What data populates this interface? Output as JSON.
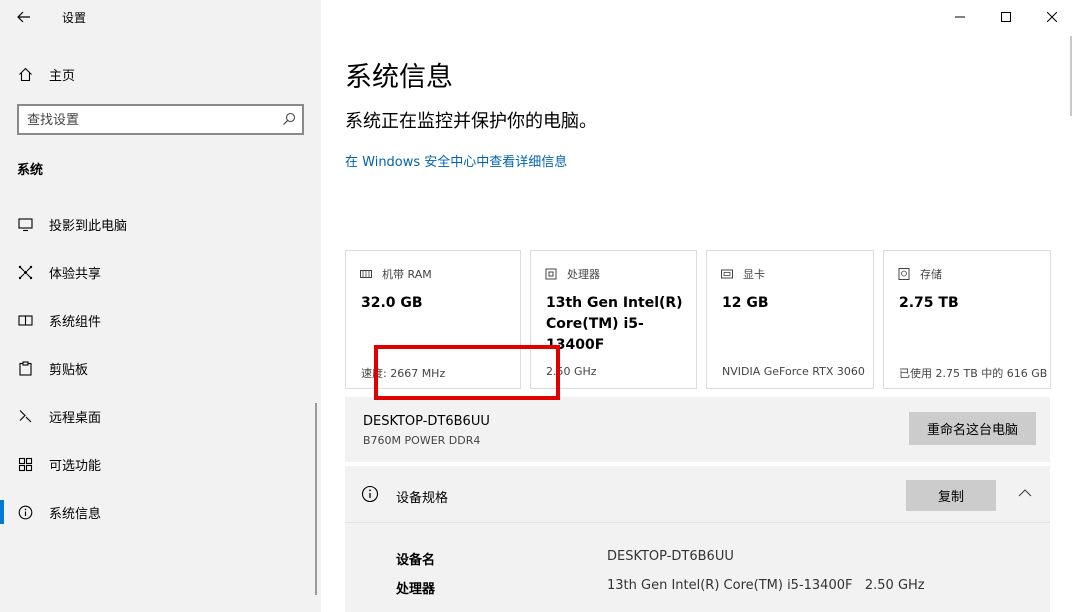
{
  "window": {
    "app_title": "设置"
  },
  "sidebar": {
    "home_label": "主页",
    "search": {
      "placeholder": "查找设置"
    },
    "section_label": "系统",
    "items": [
      {
        "label": "投影到此电脑",
        "icon": "projector-icon"
      },
      {
        "label": "体验共享",
        "icon": "share-icon"
      },
      {
        "label": "系统组件",
        "icon": "components-icon"
      },
      {
        "label": "剪贴板",
        "icon": "clipboard-icon"
      },
      {
        "label": "远程桌面",
        "icon": "remote-desktop-icon"
      },
      {
        "label": "可选功能",
        "icon": "optional-features-icon"
      },
      {
        "label": "系统信息",
        "icon": "info-icon",
        "active": true
      }
    ]
  },
  "main": {
    "title": "系统信息",
    "subtitle": "系统正在监控并保护你的电脑。",
    "security_link": "在 Windows 安全中心中查看详细信息",
    "cards": [
      {
        "label": "机带 RAM",
        "value": "32.0 GB",
        "detail": "速度: 2667 MHz",
        "icon": "memory-icon"
      },
      {
        "label": "处理器",
        "value": "13th Gen Intel(R) Core(TM) i5-13400F",
        "detail": "2.50 GHz",
        "icon": "processor-icon"
      },
      {
        "label": "显卡",
        "value": "12 GB",
        "detail": "NVIDIA GeForce RTX 3060",
        "icon": "gpu-icon"
      },
      {
        "label": "存储",
        "value": "2.75 TB",
        "detail": "已使用 2.75 TB 中的 616 GB",
        "icon": "storage-icon"
      }
    ],
    "device": {
      "name": "DESKTOP-DT6B6UU",
      "model": "B760M POWER DDR4",
      "rename_label": "重命名这台电脑"
    },
    "specs": {
      "title": "设备规格",
      "copy_label": "复制",
      "rows": [
        {
          "key": "设备名",
          "value": "DESKTOP-DT6B6UU"
        },
        {
          "key": "处理器",
          "value": "13th Gen Intel(R) Core(TM) i5-13400F   2.50 GHz"
        }
      ]
    }
  },
  "colors": {
    "accent": "#0078d7",
    "link": "#0063b1",
    "highlight": "#e00000"
  }
}
